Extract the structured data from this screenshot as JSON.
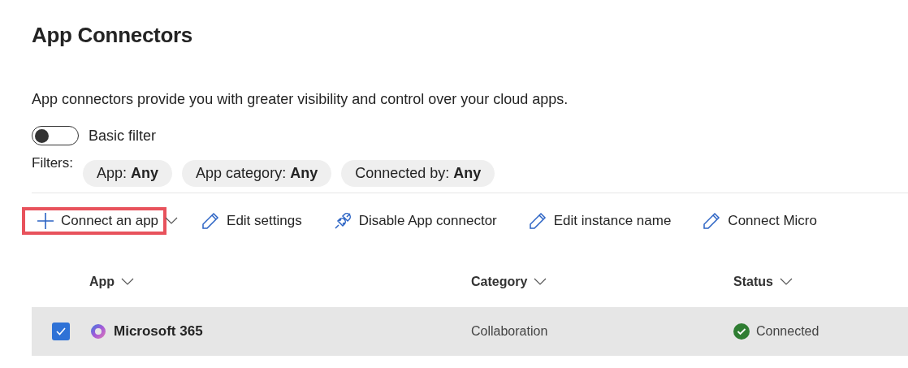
{
  "title": "App Connectors",
  "description": "App connectors provide you with greater visibility and control over your cloud apps.",
  "basic_filter": {
    "label": "Basic filter",
    "on": false
  },
  "filters": {
    "label": "Filters:",
    "chips": [
      {
        "name": "App:",
        "value": "Any"
      },
      {
        "name": "App category:",
        "value": "Any"
      },
      {
        "name": "Connected by:",
        "value": "Any"
      }
    ]
  },
  "actions": [
    {
      "kind": "add",
      "label": "Connect an app",
      "highlighted": true,
      "has_menu": true
    },
    {
      "kind": "edit",
      "label": "Edit settings",
      "highlighted": false,
      "has_menu": false
    },
    {
      "kind": "unlink",
      "label": "Disable App connector",
      "highlighted": false,
      "has_menu": false
    },
    {
      "kind": "edit",
      "label": "Edit instance name",
      "highlighted": false,
      "has_menu": false
    },
    {
      "kind": "edit",
      "label": "Connect Micro",
      "highlighted": false,
      "has_menu": false
    }
  ],
  "table": {
    "columns": [
      "App",
      "Category",
      "Status"
    ],
    "rows": [
      {
        "selected": true,
        "app": "Microsoft 365",
        "category": "Collaboration",
        "status": "Connected"
      }
    ]
  }
}
